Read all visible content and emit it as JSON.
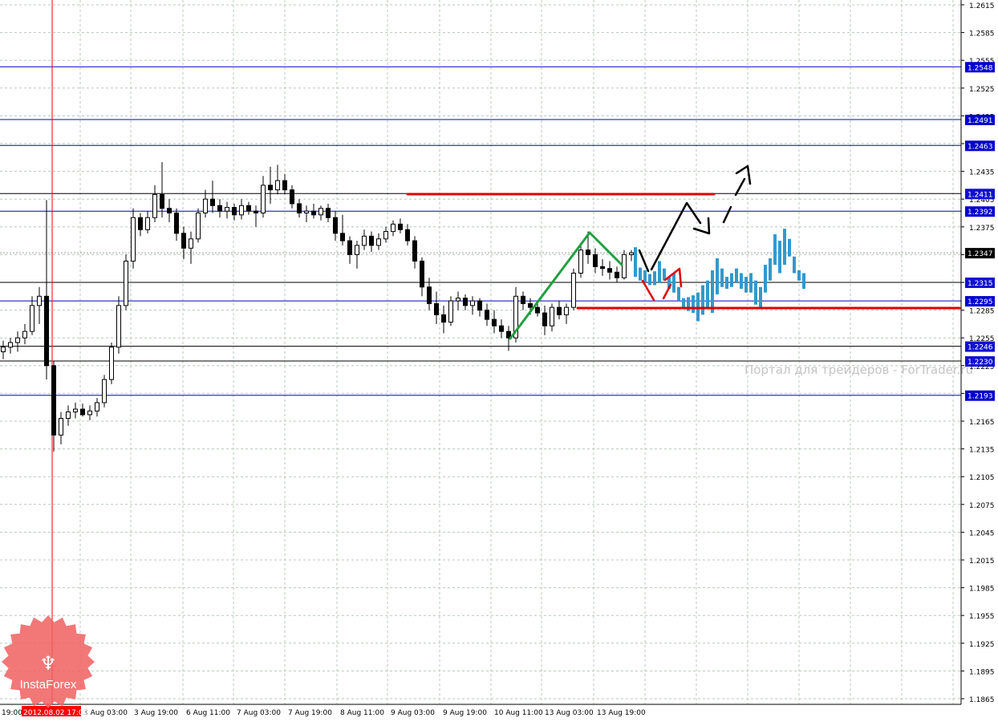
{
  "chart_data": {
    "type": "candlestick",
    "ylim": [
      1.1865,
      1.2615
    ],
    "grid": true,
    "y_ticks": [
      "1.2615",
      "1.2585",
      "1.2555",
      "1.2525",
      "1.2495",
      "1.2465",
      "1.2435",
      "1.2405",
      "1.2375",
      "1.2345",
      "1.2315",
      "1.2285",
      "1.2255",
      "1.2225",
      "1.2195",
      "1.2165",
      "1.2135",
      "1.2105",
      "1.2075",
      "1.2045",
      "1.2015",
      "1.1985",
      "1.1955",
      "1.1925",
      "1.1895",
      "1.1865"
    ],
    "x_ticks": [
      "19:00",
      "3 Aug 03:00",
      "3 Aug 19:00",
      "6 Aug 11:00",
      "7 Aug 03:00",
      "7 Aug 19:00",
      "8 Aug 11:00",
      "9 Aug 03:00",
      "9 Aug 19:00",
      "10 Aug 11:00",
      "13 Aug 03:00",
      "13 Aug 19:00"
    ],
    "cursor_time_label": "2012.08.02 17:00",
    "current_price": "1.2347",
    "levels": [
      {
        "price": "1.2548",
        "color": "#0000cc"
      },
      {
        "price": "1.2491",
        "color": "#0000cc"
      },
      {
        "price": "1.2463",
        "color": "#0000cc"
      },
      {
        "price": "1.2411",
        "color": "#000000"
      },
      {
        "price": "1.2392",
        "color": "#0000cc"
      },
      {
        "price": "1.2315",
        "color": "#000000"
      },
      {
        "price": "1.2295",
        "color": "#0000cc"
      },
      {
        "price": "1.2246",
        "color": "#000000"
      },
      {
        "price": "1.2230",
        "color": "#000000"
      },
      {
        "price": "1.2193",
        "color": "#0000cc"
      }
    ],
    "candles": [
      [
        1.224,
        1.2252,
        1.2232,
        1.2245
      ],
      [
        1.2245,
        1.2255,
        1.2238,
        1.225
      ],
      [
        1.225,
        1.2262,
        1.224,
        1.2255
      ],
      [
        1.2255,
        1.227,
        1.2248,
        1.2262
      ],
      [
        1.2262,
        1.23,
        1.2258,
        1.229
      ],
      [
        1.229,
        1.231,
        1.227,
        1.23
      ],
      [
        1.23,
        1.2404,
        1.221,
        1.2225
      ],
      [
        1.2225,
        1.223,
        1.2132,
        1.215
      ],
      [
        1.215,
        1.2175,
        1.214,
        1.2168
      ],
      [
        1.2168,
        1.2182,
        1.216,
        1.2175
      ],
      [
        1.2175,
        1.2185,
        1.2168,
        1.2178
      ],
      [
        1.2178,
        1.2184,
        1.217,
        1.2172
      ],
      [
        1.2172,
        1.2182,
        1.2166,
        1.2176
      ],
      [
        1.2176,
        1.219,
        1.217,
        1.2185
      ],
      [
        1.2185,
        1.2215,
        1.218,
        1.221
      ],
      [
        1.221,
        1.225,
        1.2205,
        1.2245
      ],
      [
        1.2245,
        1.23,
        1.2238,
        1.229
      ],
      [
        1.229,
        1.2345,
        1.2285,
        1.2338
      ],
      [
        1.2338,
        1.2395,
        1.233,
        1.2385
      ],
      [
        1.2385,
        1.239,
        1.2365,
        1.2372
      ],
      [
        1.2372,
        1.2392,
        1.2368,
        1.2385
      ],
      [
        1.2385,
        1.242,
        1.238,
        1.241
      ],
      [
        1.241,
        1.2445,
        1.2385,
        1.2395
      ],
      [
        1.2395,
        1.2405,
        1.238,
        1.239
      ],
      [
        1.239,
        1.2395,
        1.236,
        1.2368
      ],
      [
        1.2368,
        1.2375,
        1.234,
        1.2352
      ],
      [
        1.2352,
        1.237,
        1.2335,
        1.2362
      ],
      [
        1.2362,
        1.2395,
        1.2358,
        1.239
      ],
      [
        1.239,
        1.2415,
        1.2385,
        1.2405
      ],
      [
        1.2405,
        1.2425,
        1.239,
        1.2398
      ],
      [
        1.2398,
        1.2405,
        1.2385,
        1.2392
      ],
      [
        1.2392,
        1.2402,
        1.2384,
        1.2396
      ],
      [
        1.2396,
        1.24,
        1.2382,
        1.2388
      ],
      [
        1.2388,
        1.2405,
        1.2383,
        1.2398
      ],
      [
        1.2398,
        1.2402,
        1.2388,
        1.2392
      ],
      [
        1.2392,
        1.2398,
        1.2375,
        1.239
      ],
      [
        1.239,
        1.243,
        1.2385,
        1.242
      ],
      [
        1.242,
        1.244,
        1.24,
        1.2415
      ],
      [
        1.2415,
        1.2442,
        1.241,
        1.2425
      ],
      [
        1.2425,
        1.2432,
        1.241,
        1.2415
      ],
      [
        1.2415,
        1.242,
        1.2395,
        1.24
      ],
      [
        1.24,
        1.2405,
        1.2385,
        1.239
      ],
      [
        1.239,
        1.2398,
        1.238,
        1.2392
      ],
      [
        1.2392,
        1.24,
        1.2384,
        1.2388
      ],
      [
        1.2388,
        1.2398,
        1.2382,
        1.2395
      ],
      [
        1.2395,
        1.24,
        1.238,
        1.2385
      ],
      [
        1.2385,
        1.2392,
        1.236,
        1.2368
      ],
      [
        1.2368,
        1.2388,
        1.2355,
        1.236
      ],
      [
        1.236,
        1.2365,
        1.2335,
        1.2345
      ],
      [
        1.2345,
        1.236,
        1.233,
        1.2355
      ],
      [
        1.2355,
        1.2372,
        1.235,
        1.2365
      ],
      [
        1.2365,
        1.237,
        1.2348,
        1.2355
      ],
      [
        1.2355,
        1.2368,
        1.235,
        1.2362
      ],
      [
        1.2362,
        1.2375,
        1.2358,
        1.237
      ],
      [
        1.237,
        1.2382,
        1.2365,
        1.2378
      ],
      [
        1.2378,
        1.2384,
        1.2368,
        1.2372
      ],
      [
        1.2372,
        1.2378,
        1.2355,
        1.236
      ],
      [
        1.236,
        1.2365,
        1.233,
        1.2338
      ],
      [
        1.2338,
        1.2342,
        1.23,
        1.231
      ],
      [
        1.231,
        1.232,
        1.2285,
        1.2292
      ],
      [
        1.2292,
        1.2305,
        1.227,
        1.228
      ],
      [
        1.228,
        1.229,
        1.226,
        1.2272
      ],
      [
        1.2272,
        1.23,
        1.2268,
        1.2295
      ],
      [
        1.2295,
        1.2305,
        1.2285,
        1.2298
      ],
      [
        1.2298,
        1.2302,
        1.2285,
        1.229
      ],
      [
        1.229,
        1.23,
        1.228,
        1.2295
      ],
      [
        1.2295,
        1.2298,
        1.2278,
        1.2285
      ],
      [
        1.2285,
        1.2292,
        1.2268,
        1.2275
      ],
      [
        1.2275,
        1.2285,
        1.226,
        1.2268
      ],
      [
        1.2268,
        1.2275,
        1.2255,
        1.2262
      ],
      [
        1.2262,
        1.2268,
        1.2241,
        1.2255
      ],
      [
        1.2255,
        1.231,
        1.225,
        1.23
      ],
      [
        1.23,
        1.2305,
        1.2285,
        1.2292
      ],
      [
        1.2292,
        1.2298,
        1.228,
        1.2288
      ],
      [
        1.2288,
        1.2295,
        1.2278,
        1.2282
      ],
      [
        1.2282,
        1.229,
        1.2258,
        1.2268
      ],
      [
        1.2268,
        1.2292,
        1.2262,
        1.2288
      ],
      [
        1.2288,
        1.2295,
        1.2275,
        1.228
      ],
      [
        1.228,
        1.2292,
        1.227,
        1.2288
      ],
      [
        1.2288,
        1.233,
        1.2285,
        1.2325
      ],
      [
        1.2325,
        1.2355,
        1.232,
        1.235
      ],
      [
        1.235,
        1.237,
        1.2335,
        1.2345
      ],
      [
        1.2345,
        1.2352,
        1.2325,
        1.2332
      ],
      [
        1.2332,
        1.234,
        1.2322,
        1.233
      ],
      [
        1.233,
        1.2338,
        1.2318,
        1.2326
      ],
      [
        1.2326,
        1.2332,
        1.2315,
        1.232
      ],
      [
        1.232,
        1.235,
        1.2318,
        1.2345
      ],
      [
        1.2345,
        1.235,
        1.2338,
        1.2347
      ]
    ],
    "projection_bars": [
      [
        1.2353,
        1.2321
      ],
      [
        1.2331,
        1.2317
      ],
      [
        1.2328,
        1.2315
      ],
      [
        1.2324,
        1.2312
      ],
      [
        1.2327,
        1.2312
      ],
      [
        1.2338,
        1.2315
      ],
      [
        1.233,
        1.2317
      ],
      [
        1.2321,
        1.2308
      ],
      [
        1.2325,
        1.2304
      ],
      [
        1.231,
        1.2295
      ],
      [
        1.2298,
        1.2288
      ],
      [
        1.2299,
        1.2284
      ],
      [
        1.2301,
        1.2282
      ],
      [
        1.2304,
        1.2273
      ],
      [
        1.2312,
        1.228
      ],
      [
        1.2317,
        1.2286
      ],
      [
        1.2328,
        1.2282
      ],
      [
        1.2341,
        1.2302
      ],
      [
        1.233,
        1.231
      ],
      [
        1.2321,
        1.2308
      ],
      [
        1.2325,
        1.231
      ],
      [
        1.233,
        1.2315
      ],
      [
        1.2325,
        1.2308
      ],
      [
        1.2321,
        1.2304
      ],
      [
        1.2325,
        1.2304
      ],
      [
        1.2317,
        1.2291
      ],
      [
        1.231,
        1.2288
      ],
      [
        1.2334,
        1.2304
      ],
      [
        1.2341,
        1.2317
      ],
      [
        1.2367,
        1.2334
      ],
      [
        1.236,
        1.2325
      ],
      [
        1.2373,
        1.2334
      ],
      [
        1.2362,
        1.2343
      ],
      [
        1.2343,
        1.2325
      ],
      [
        1.2328,
        1.2317
      ],
      [
        1.2325,
        1.2308
      ]
    ],
    "colors": {
      "bull": "#ffffff",
      "bear": "#000000",
      "projection": "#3399cc",
      "level_blue": "#0000cc",
      "cursor": "#ff0000",
      "drawing_red": "#e00000",
      "drawing_green": "#20a040"
    }
  },
  "watermark": "Портал для трейдеров - ForTrader.ru",
  "logo": {
    "text": "InstaForex"
  }
}
